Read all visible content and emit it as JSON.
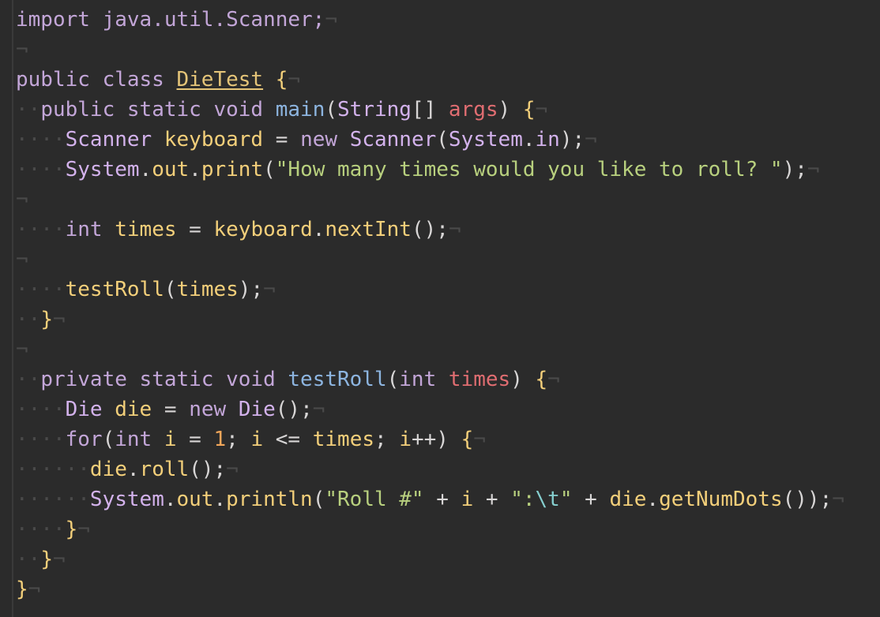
{
  "editor": {
    "language": "java",
    "eol_marker": "¬",
    "whitespace_marker": "·",
    "lines": [
      [
        {
          "t": "kw",
          "v": "import java.util.Scanner;"
        }
      ],
      [],
      [
        {
          "t": "kw",
          "v": "public class "
        },
        {
          "t": "cls",
          "v": "DieTest"
        },
        {
          "t": "pl",
          "v": " "
        },
        {
          "t": "yel",
          "v": "{"
        }
      ],
      [
        {
          "t": "ws",
          "v": "··"
        },
        {
          "t": "kw",
          "v": "public static void "
        },
        {
          "t": "blue",
          "v": "main"
        },
        {
          "t": "pl",
          "v": "("
        },
        {
          "t": "typ",
          "v": "String"
        },
        {
          "t": "pl",
          "v": "[] "
        },
        {
          "t": "pink",
          "v": "args"
        },
        {
          "t": "pl",
          "v": ") "
        },
        {
          "t": "yel",
          "v": "{"
        }
      ],
      [
        {
          "t": "ws",
          "v": "····"
        },
        {
          "t": "typ",
          "v": "Scanner "
        },
        {
          "t": "yel",
          "v": "keyboard"
        },
        {
          "t": "pl",
          "v": " = "
        },
        {
          "t": "kw",
          "v": "new "
        },
        {
          "t": "typ",
          "v": "Scanner"
        },
        {
          "t": "pl",
          "v": "("
        },
        {
          "t": "typ",
          "v": "System"
        },
        {
          "t": "pl",
          "v": "."
        },
        {
          "t": "typ",
          "v": "in"
        },
        {
          "t": "pl",
          "v": ");"
        }
      ],
      [
        {
          "t": "ws",
          "v": "····"
        },
        {
          "t": "typ",
          "v": "System"
        },
        {
          "t": "pl",
          "v": "."
        },
        {
          "t": "yel",
          "v": "out"
        },
        {
          "t": "pl",
          "v": "."
        },
        {
          "t": "yel",
          "v": "print"
        },
        {
          "t": "pl",
          "v": "("
        },
        {
          "t": "str",
          "v": "\"How many times would you like to roll? \""
        },
        {
          "t": "pl",
          "v": ");"
        }
      ],
      [],
      [
        {
          "t": "ws",
          "v": "····"
        },
        {
          "t": "kw",
          "v": "int "
        },
        {
          "t": "yel",
          "v": "times"
        },
        {
          "t": "pl",
          "v": " = "
        },
        {
          "t": "yel",
          "v": "keyboard"
        },
        {
          "t": "pl",
          "v": "."
        },
        {
          "t": "yel",
          "v": "nextInt"
        },
        {
          "t": "pl",
          "v": "();"
        }
      ],
      [],
      [
        {
          "t": "ws",
          "v": "····"
        },
        {
          "t": "yel",
          "v": "testRoll"
        },
        {
          "t": "pl",
          "v": "("
        },
        {
          "t": "yel",
          "v": "times"
        },
        {
          "t": "pl",
          "v": ");"
        }
      ],
      [
        {
          "t": "ws",
          "v": "··"
        },
        {
          "t": "yel",
          "v": "}"
        }
      ],
      [],
      [
        {
          "t": "ws",
          "v": "··"
        },
        {
          "t": "kw",
          "v": "private static void "
        },
        {
          "t": "blue",
          "v": "testRoll"
        },
        {
          "t": "pl",
          "v": "("
        },
        {
          "t": "kw",
          "v": "int "
        },
        {
          "t": "pink",
          "v": "times"
        },
        {
          "t": "pl",
          "v": ") "
        },
        {
          "t": "yel",
          "v": "{"
        }
      ],
      [
        {
          "t": "ws",
          "v": "····"
        },
        {
          "t": "typ",
          "v": "Die "
        },
        {
          "t": "yel",
          "v": "die"
        },
        {
          "t": "pl",
          "v": " = "
        },
        {
          "t": "kw",
          "v": "new "
        },
        {
          "t": "typ",
          "v": "Die"
        },
        {
          "t": "pl",
          "v": "();"
        }
      ],
      [
        {
          "t": "ws",
          "v": "····"
        },
        {
          "t": "kw",
          "v": "for"
        },
        {
          "t": "pl",
          "v": "("
        },
        {
          "t": "kw",
          "v": "int "
        },
        {
          "t": "yel",
          "v": "i"
        },
        {
          "t": "pl",
          "v": " = "
        },
        {
          "t": "num",
          "v": "1"
        },
        {
          "t": "pl",
          "v": "; "
        },
        {
          "t": "yel",
          "v": "i"
        },
        {
          "t": "pl",
          "v": " <= "
        },
        {
          "t": "yel",
          "v": "times"
        },
        {
          "t": "pl",
          "v": "; "
        },
        {
          "t": "yel",
          "v": "i"
        },
        {
          "t": "pl",
          "v": "++) "
        },
        {
          "t": "yel",
          "v": "{"
        }
      ],
      [
        {
          "t": "ws",
          "v": "······"
        },
        {
          "t": "yel",
          "v": "die"
        },
        {
          "t": "pl",
          "v": "."
        },
        {
          "t": "yel",
          "v": "roll"
        },
        {
          "t": "pl",
          "v": "();"
        }
      ],
      [
        {
          "t": "ws",
          "v": "······"
        },
        {
          "t": "typ",
          "v": "System"
        },
        {
          "t": "pl",
          "v": "."
        },
        {
          "t": "yel",
          "v": "out"
        },
        {
          "t": "pl",
          "v": "."
        },
        {
          "t": "yel",
          "v": "println"
        },
        {
          "t": "pl",
          "v": "("
        },
        {
          "t": "str",
          "v": "\"Roll #\""
        },
        {
          "t": "pl",
          "v": " + "
        },
        {
          "t": "yel",
          "v": "i"
        },
        {
          "t": "pl",
          "v": " + "
        },
        {
          "t": "str",
          "v": "\":"
        },
        {
          "t": "esc",
          "v": "\\t"
        },
        {
          "t": "str",
          "v": "\""
        },
        {
          "t": "pl",
          "v": " + "
        },
        {
          "t": "yel",
          "v": "die"
        },
        {
          "t": "pl",
          "v": "."
        },
        {
          "t": "yel",
          "v": "getNumDots"
        },
        {
          "t": "pl",
          "v": "());"
        }
      ],
      [
        {
          "t": "ws",
          "v": "····"
        },
        {
          "t": "yel",
          "v": "}"
        }
      ],
      [
        {
          "t": "ws",
          "v": "··"
        },
        {
          "t": "yel",
          "v": "}"
        }
      ],
      [
        {
          "t": "yel",
          "v": "}"
        }
      ]
    ]
  },
  "colors": {
    "background": "#2b2b2b",
    "keyword": "#c3a6d8",
    "identifier": "#f3cf7a",
    "method_name": "#8db5e0",
    "parameter": "#e06d71",
    "string": "#b8d07e",
    "escape": "#86cfcf",
    "number": "#f2a65a",
    "invisibles": "#4a4a4a"
  }
}
